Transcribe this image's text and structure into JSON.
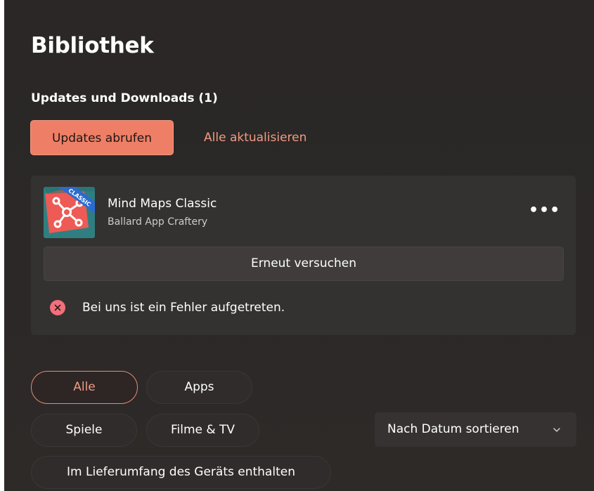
{
  "page": {
    "title": "Bibliothek"
  },
  "updates": {
    "section_title": "Updates und Downloads (1)",
    "get_updates_label": "Updates abrufen",
    "update_all_label": "Alle aktualisieren"
  },
  "app_card": {
    "icon_badge": "CLASSIC",
    "name": "Mind Maps Classic",
    "publisher": "Ballard App Craftery",
    "more_label": "•••",
    "retry_label": "Erneut versuchen",
    "error_message": "Bei uns ist ein Fehler aufgetreten."
  },
  "filters": {
    "items": [
      {
        "label": "Alle",
        "active": true
      },
      {
        "label": "Apps",
        "active": false
      },
      {
        "label": "Spiele",
        "active": false
      },
      {
        "label": "Filme & TV",
        "active": false
      },
      {
        "label": "Im Lieferumfang des Geräts enthalten",
        "active": false
      }
    ]
  },
  "sort": {
    "label": "Nach Datum sortieren"
  },
  "icons": {
    "error": "error-circle-icon",
    "chevron": "chevron-down-icon",
    "more": "more-horizontal-icon",
    "app": "mind-maps-app-icon"
  },
  "colors": {
    "accent": "#ee7f66",
    "accent_text": "#f19b84",
    "error": "#f1707b"
  }
}
